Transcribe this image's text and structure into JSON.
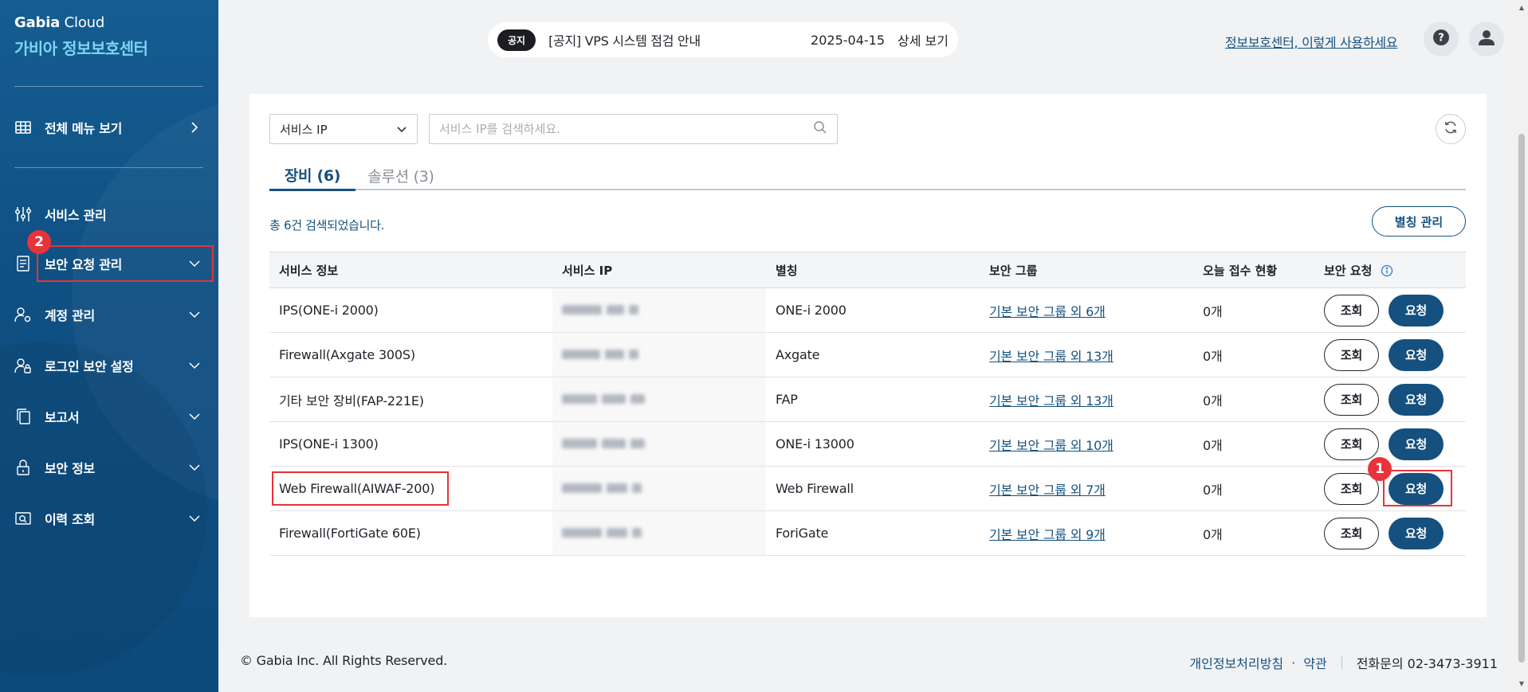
{
  "sidebar": {
    "brand_company": "Gabia",
    "brand_product": "Cloud",
    "brand_subtitle": "가비아 정보보호센터",
    "all_menu_label": "전체 메뉴 보기",
    "items": [
      {
        "label": "서비스 관리",
        "icon": "sliders-icon"
      },
      {
        "label": "보안 요청 관리",
        "icon": "document-list-icon"
      },
      {
        "label": "계정 관리",
        "icon": "user-gear-icon"
      },
      {
        "label": "로그인 보안 설정",
        "icon": "user-lock-icon"
      },
      {
        "label": "보고서",
        "icon": "copy-icon"
      },
      {
        "label": "보안 정보",
        "icon": "lock-icon"
      },
      {
        "label": "이력 조회",
        "icon": "search-history-icon"
      }
    ]
  },
  "annotations": {
    "badge_1": "1",
    "badge_2": "2",
    "highlight_color": "#e8333a"
  },
  "topbar": {
    "notice_tag": "공지",
    "notice_text": "[공지] VPS 시스템 점검 안내",
    "notice_date": "2025-04-15",
    "notice_link": "상세 보기",
    "guide_link": "정보보호센터, 이렇게 사용하세요",
    "help_icon": "help-icon",
    "user_icon": "user-icon"
  },
  "filter": {
    "select_value": "서비스 IP",
    "search_placeholder": "서비스 IP를 검색하세요."
  },
  "tabs": [
    {
      "label": "장비 (6)",
      "active": true
    },
    {
      "label": "솔루션 (3)",
      "active": false
    }
  ],
  "result_text": "총 6건 검색되었습니다.",
  "alias_button": "별칭 관리",
  "table": {
    "headers": [
      "서비스 정보",
      "서비스 IP",
      "별칭",
      "보안 그룹",
      "오늘 접수 현황",
      "보안 요청"
    ],
    "view_label": "조회",
    "request_label": "요청",
    "rows": [
      {
        "service": "IPS(ONE-i 2000)",
        "alias": "ONE-i 2000",
        "group": "기본 보안 그룹 외 6개",
        "today": "0개"
      },
      {
        "service": "Firewall(Axgate 300S)",
        "alias": "Axgate",
        "group": "기본 보안 그룹 외 13개",
        "today": "0개"
      },
      {
        "service": "기타 보안 장비(FAP-221E)",
        "alias": "FAP",
        "group": "기본 보안 그룹 외 13개",
        "today": "0개"
      },
      {
        "service": "IPS(ONE-i 1300)",
        "alias": "ONE-i 13000",
        "group": "기본 보안 그룹 외 10개",
        "today": "0개"
      },
      {
        "service": "Web Firewall(AIWAF-200)",
        "alias": "Web Firewall",
        "group": "기본 보안 그룹 외 7개",
        "today": "0개"
      },
      {
        "service": "Firewall(FortiGate 60E)",
        "alias": "ForiGate",
        "group": "기본 보안 그룹 외 9개",
        "today": "0개"
      }
    ]
  },
  "footer": {
    "copyright": "© Gabia Inc. All Rights Reserved.",
    "privacy": "개인정보처리방침",
    "dot": "·",
    "terms": "약관",
    "phone": "전화문의 02-3473-3911"
  },
  "colors": {
    "brand_blue": "#16527f",
    "sidebar_bg": "#0f4f82",
    "accent_cyan": "#7fd3f7"
  }
}
